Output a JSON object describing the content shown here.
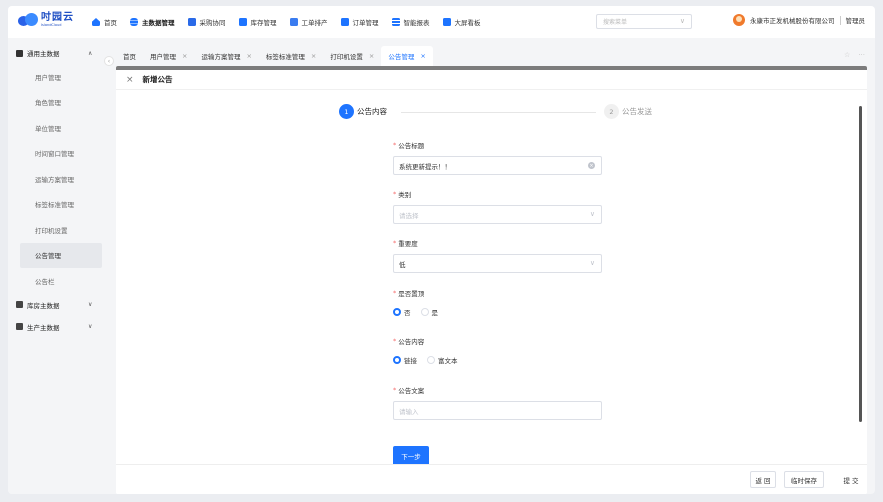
{
  "app": {
    "logo_cn": "吋园云",
    "logo_en": "IslandCloud"
  },
  "nav": [
    {
      "label": "首页",
      "icon": "home-icon",
      "color": "#1e74ff"
    },
    {
      "label": "主数据管理",
      "icon": "database-icon",
      "color": "#1e74ff",
      "active": true
    },
    {
      "label": "采购协同",
      "icon": "cart-icon",
      "color": "#1e74ff"
    },
    {
      "label": "库存管理",
      "icon": "warehouse-icon",
      "color": "#1e74ff"
    },
    {
      "label": "工单排产",
      "icon": "clipboard-icon",
      "color": "#1e74ff"
    },
    {
      "label": "订单管理",
      "icon": "order-icon",
      "color": "#1e74ff"
    },
    {
      "label": "智能报表",
      "icon": "report-icon",
      "color": "#1e74ff"
    },
    {
      "label": "大屏看板",
      "icon": "dashboard-icon",
      "color": "#1e74ff"
    }
  ],
  "search": {
    "placeholder": "搜索菜单"
  },
  "user": {
    "company": "永康市正发机械股份有限公司",
    "role": "管理员"
  },
  "sidebar": {
    "group_main": "通用主数据",
    "items": [
      {
        "label": "用户管理"
      },
      {
        "label": "角色管理"
      },
      {
        "label": "单位管理"
      },
      {
        "label": "时间窗口管理"
      },
      {
        "label": "运输方案管理"
      },
      {
        "label": "标签标准管理"
      },
      {
        "label": "打印机设置"
      },
      {
        "label": "公告管理",
        "active": true
      },
      {
        "label": "公告栏"
      }
    ],
    "group_inventory": "库房主数据",
    "group_production": "生产主数据"
  },
  "tabs": [
    {
      "label": "首页",
      "closable": false
    },
    {
      "label": "用户管理",
      "closable": true
    },
    {
      "label": "运输方案管理",
      "closable": true
    },
    {
      "label": "标签标准管理",
      "closable": true
    },
    {
      "label": "打印机设置",
      "closable": true
    },
    {
      "label": "公告管理",
      "closable": true,
      "active": true
    }
  ],
  "page": {
    "title": "新增公告",
    "steps": [
      {
        "num": "1",
        "label": "公告内容",
        "active": true
      },
      {
        "num": "2",
        "label": "公告发送",
        "active": false
      }
    ]
  },
  "form": {
    "title_label": "公告标题",
    "title_value": "系统更新提示！！",
    "category_label": "类别",
    "category_placeholder": "请选择",
    "priority_label": "重要度",
    "priority_value": "低",
    "pinned_label": "是否置顶",
    "pinned_options": [
      "否",
      "是"
    ],
    "pinned_selected": 0,
    "content_label": "公告内容",
    "content_options": [
      "链接",
      "富文本"
    ],
    "content_selected": 0,
    "copy_label": "公告文案",
    "copy_placeholder": "请输入",
    "next_label": "下一步"
  },
  "footer": {
    "back_label": "返 回",
    "draft_label": "临时保存",
    "submit_label": "提 交"
  },
  "colors": {
    "primary": "#1e74ff",
    "required": "#f56c6c"
  }
}
